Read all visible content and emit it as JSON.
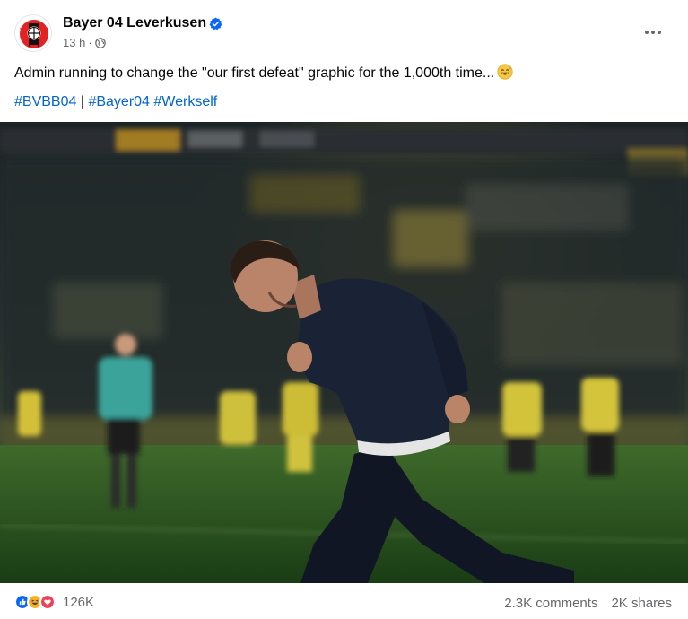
{
  "post": {
    "page_name": "Bayer 04 Leverkusen",
    "time": "13 h",
    "separator": "·",
    "caption": "Admin running to change the \"our first defeat\" graphic for the 1,000th time...",
    "hashtags": [
      "#BVBB04",
      "#Bayer04",
      "#Werkself"
    ],
    "hashtag_divider": "|"
  },
  "footer": {
    "reaction_count": "126K",
    "comments": "2.3K comments",
    "shares": "2K shares"
  },
  "icons": {
    "verified": "verified-badge-icon",
    "privacy": "globe-icon",
    "menu": "more-options-icon",
    "reactions": [
      "like-icon",
      "haha-icon",
      "love-icon"
    ]
  },
  "colors": {
    "accent": "#0064d1",
    "verified": "#0866ff",
    "love": "#f33e58",
    "haha": "#f7b125",
    "muted": "#65676b"
  }
}
